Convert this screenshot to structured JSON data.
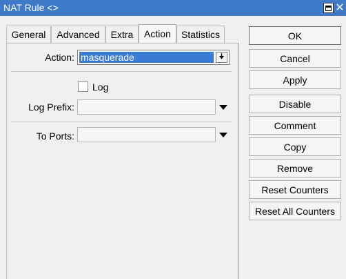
{
  "window": {
    "title": "NAT Rule <>"
  },
  "tabs": [
    {
      "label": "General"
    },
    {
      "label": "Advanced"
    },
    {
      "label": "Extra"
    },
    {
      "label": "Action"
    },
    {
      "label": "Statistics"
    }
  ],
  "form": {
    "action_label": "Action:",
    "action_value": "masquerade",
    "log_label": "Log",
    "log_checked": false,
    "log_prefix_label": "Log Prefix:",
    "log_prefix_value": "",
    "to_ports_label": "To Ports:",
    "to_ports_value": ""
  },
  "buttons": {
    "ok": "OK",
    "cancel": "Cancel",
    "apply": "Apply",
    "disable": "Disable",
    "comment": "Comment",
    "copy": "Copy",
    "remove": "Remove",
    "reset_counters": "Reset Counters",
    "reset_all_counters": "Reset All Counters"
  },
  "colors": {
    "titlebar": "#3f7ac8",
    "selection": "#3a7bd5"
  }
}
